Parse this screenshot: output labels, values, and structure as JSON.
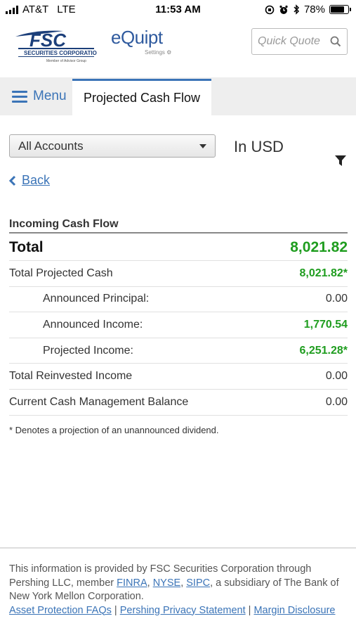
{
  "status_bar": {
    "carrier": "AT&T",
    "network": "LTE",
    "time": "11:53 AM",
    "battery_percent": "78%",
    "battery_level": 0.78
  },
  "header": {
    "logo_text": "FSC",
    "logo_subtitle": "SECURITIES CORPORATION",
    "logo_tagline": "Member of Advisor Group",
    "app_name": "eQuipt",
    "app_settings": "Settings ⚙",
    "quick_quote_placeholder": "Quick Quote"
  },
  "nav": {
    "menu_label": "Menu",
    "active_tab": "Projected Cash Flow"
  },
  "filters": {
    "account_selected": "All Accounts",
    "currency": "In USD"
  },
  "back_label": "Back",
  "cash_flow": {
    "section_title": "Incoming Cash Flow",
    "total_label": "Total",
    "total_value": "8,021.82",
    "rows": [
      {
        "label": "Total Projected Cash",
        "value": "8,021.82*",
        "green": true,
        "indent": false
      },
      {
        "label": "Announced Principal:",
        "value": "0.00",
        "green": false,
        "indent": true
      },
      {
        "label": "Announced Income:",
        "value": "1,770.54",
        "green": true,
        "indent": true
      },
      {
        "label": "Projected Income:",
        "value": "6,251.28*",
        "green": true,
        "indent": true
      },
      {
        "label": "Total Reinvested Income",
        "value": "0.00",
        "green": false,
        "indent": false
      },
      {
        "label": "Current Cash Management Balance",
        "value": "0.00",
        "green": false,
        "indent": false
      }
    ],
    "footnote": "* Denotes a projection of an unannounced dividend."
  },
  "footer": {
    "text_1": "This information is provided by FSC Securities Corporation through Pershing LLC, member ",
    "finra": "FINRA",
    "sep_comma_1": ", ",
    "nyse": "NYSE",
    "sep_comma_2": ", ",
    "sipc": "SIPC",
    "text_2": ", a subsidiary of The Bank of New York Mellon Corporation.",
    "asset_protection": "Asset Protection FAQs",
    "pipe_1": " | ",
    "privacy": "Pershing Privacy Statement",
    "pipe_2": " | ",
    "margin": "Margin Disclosure"
  },
  "colors": {
    "accent": "#3b74b7",
    "positive": "#1f9d1f",
    "brand_navy": "#1c3f7a"
  }
}
